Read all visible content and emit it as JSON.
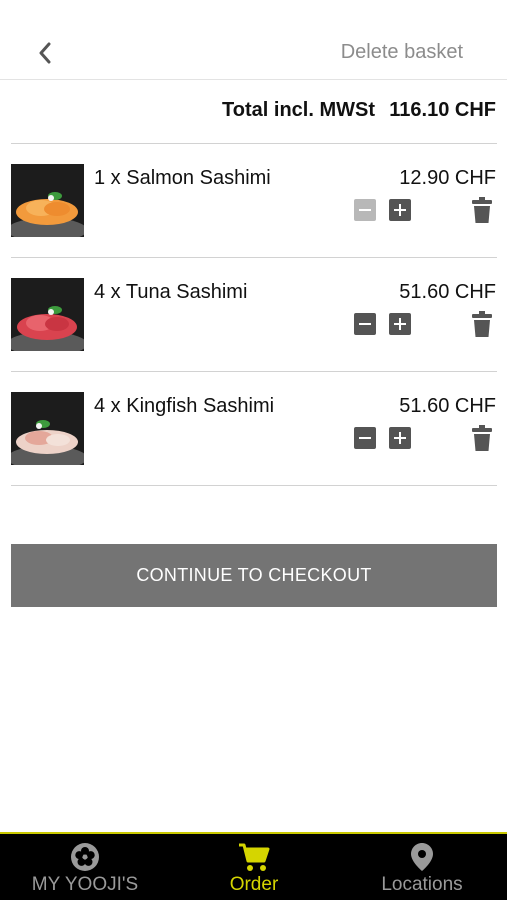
{
  "header": {
    "delete_label": "Delete basket"
  },
  "total": {
    "label": "Total incl. MWSt",
    "value": "116.10 CHF"
  },
  "items": [
    {
      "name": "1 x Salmon Sashimi",
      "price": "12.90 CHF",
      "image": "salmon-sashimi-photo",
      "minus_enabled": false
    },
    {
      "name": "4 x Tuna Sashimi",
      "price": "51.60 CHF",
      "image": "tuna-sashimi-photo",
      "minus_enabled": true
    },
    {
      "name": "4 x Kingfish Sashimi",
      "price": "51.60 CHF",
      "image": "kingfish-sashimi-photo",
      "minus_enabled": true
    }
  ],
  "checkout": {
    "label": "CONTINUE TO CHECKOUT"
  },
  "tabs": [
    {
      "label": "MY YOOJI'S",
      "icon": "flower-icon",
      "active": false
    },
    {
      "label": "Order",
      "icon": "cart-icon",
      "active": true
    },
    {
      "label": "Locations",
      "icon": "location-pin-icon",
      "active": false
    }
  ],
  "colors": {
    "accent": "#d5d500",
    "button": "#747474",
    "tabbar": "#000000",
    "inactive_tab": "#9a9a9a"
  }
}
